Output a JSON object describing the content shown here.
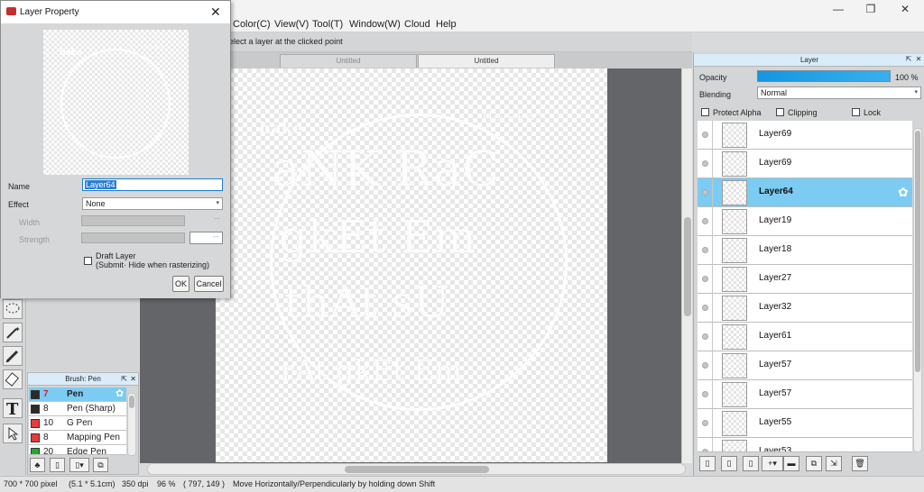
{
  "menu": {
    "items": [
      "Color(C)",
      "View(V)",
      "Tool(T)",
      "Window(W)",
      "Cloud",
      "Help"
    ],
    "minimize": "—",
    "maximize": "❐",
    "close": "✕"
  },
  "toolbar": {
    "hint": "elect a layer at the clicked point"
  },
  "tabs": [
    {
      "label": "Untitled",
      "active": false
    },
    {
      "label": "Untitled",
      "active": true
    }
  ],
  "canvas": {
    "art_lines": [
      "hake",
      "H+++<>",
      "aNK RaC",
      "gkEt Em",
      "thAt sU",
      "rAt gkEt Em"
    ]
  },
  "dialog": {
    "title": "Layer Property",
    "close_glyph": "✕",
    "name_label": "Name",
    "name_value": "Layer64",
    "effect_label": "Effect",
    "effect_value": "None",
    "width_label": "Width",
    "width_value": "---",
    "strength_label": "Strength",
    "strength_value": "---",
    "draft_label": "Draft Layer",
    "draft_sub": "(Submit· Hide when rasterizing)",
    "ok_label": "OK",
    "cancel_label": "Cancel"
  },
  "brush_panel": {
    "title": "Brush: Pen",
    "items": [
      {
        "size": "7",
        "name": "Pen",
        "color": "#2b2b2b",
        "selected": true
      },
      {
        "size": "8",
        "name": "Pen (Sharp)",
        "color": "#2b2b2b",
        "selected": false
      },
      {
        "size": "10",
        "name": "G Pen",
        "color": "#e83a3a",
        "selected": false
      },
      {
        "size": "8",
        "name": "Mapping Pen",
        "color": "#e83a3a",
        "selected": false
      },
      {
        "size": "20",
        "name": "Edge Pen",
        "color": "#28a828",
        "selected": false
      }
    ]
  },
  "layer_panel": {
    "title": "Layer",
    "opacity_label": "Opacity",
    "opacity_value": "100 %",
    "opacity_fraction": 1.0,
    "blending_label": "Blending",
    "blending_value": "Normal",
    "protect_alpha": "Protect Alpha",
    "clipping": "Clipping",
    "lock": "Lock",
    "layers": [
      {
        "name": "Layer69",
        "selected": false
      },
      {
        "name": "Layer69",
        "selected": false
      },
      {
        "name": "Layer64",
        "selected": true
      },
      {
        "name": "Layer19",
        "selected": false
      },
      {
        "name": "Layer18",
        "selected": false
      },
      {
        "name": "Layer27",
        "selected": false
      },
      {
        "name": "Layer32",
        "selected": false
      },
      {
        "name": "Layer61",
        "selected": false
      },
      {
        "name": "Layer57",
        "selected": false
      },
      {
        "name": "Layer57",
        "selected": false
      },
      {
        "name": "Layer55",
        "selected": false
      },
      {
        "name": "Layer53",
        "selected": false
      }
    ]
  },
  "status": {
    "size": "700 * 700 pixel",
    "cm": "(5.1 * 5.1cm)",
    "dpi": "350 dpi",
    "zoom": "96 %",
    "coords": "( 797, 149 )",
    "message": "Move Horizontally/Perpendicularly by holding down Shift"
  },
  "colors": {
    "accent": "#7ccbf2",
    "selection": "#2a7fd4",
    "canvas_bg": "#646569"
  }
}
